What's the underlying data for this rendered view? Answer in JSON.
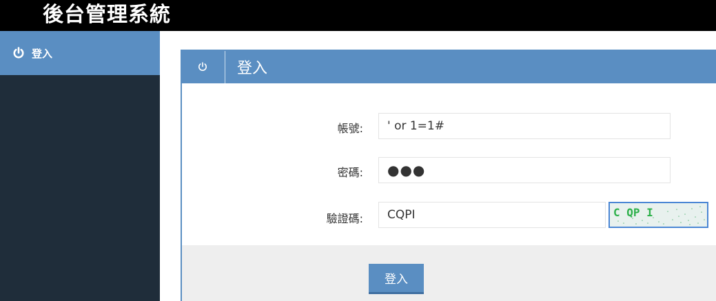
{
  "header": {
    "title": "後台管理系統"
  },
  "sidebar": {
    "items": [
      {
        "label": "登入",
        "icon": "power-icon"
      }
    ]
  },
  "panel": {
    "title": "登入",
    "icon": "power-icon"
  },
  "form": {
    "account_label": "帳號:",
    "account_value": "' or 1=1#",
    "password_label": "密碼:",
    "password_value": "●●●",
    "captcha_label": "驗證碼:",
    "captcha_value": "CQPI",
    "captcha_image_text": "C QP I"
  },
  "footer": {
    "login_button": "登入"
  },
  "colors": {
    "accent": "#5a8ec2",
    "sidebar_bg": "#1f2d3a",
    "topbar_bg": "#000000",
    "footer_bg": "#eeeeee"
  }
}
